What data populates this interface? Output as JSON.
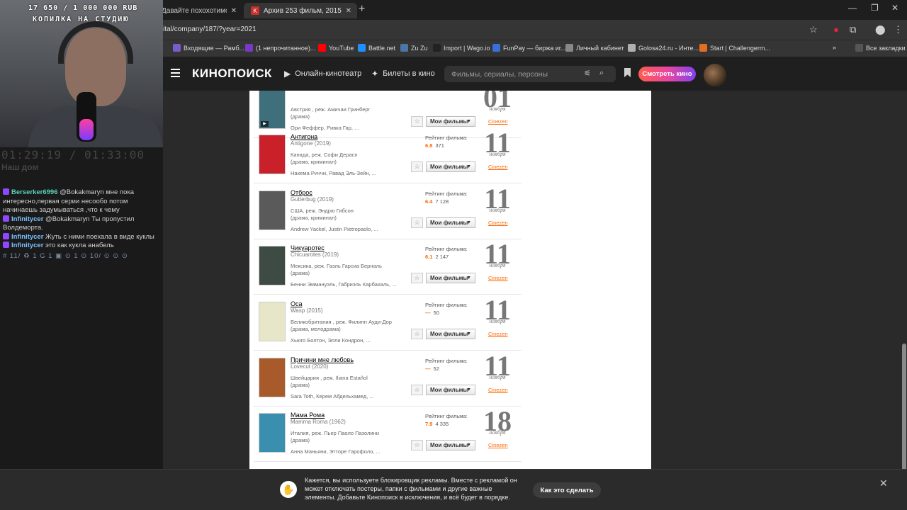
{
  "overlay": {
    "counter": "17 650 / 1 000 000 RUB",
    "kopilka": "КОПИЛКА НА СТУДИЮ",
    "timer": "01:29:19 / 01:33:00",
    "stream_title": "Наш дом",
    "chat": [
      {
        "user": "Berserker6996",
        "text": " @Bokakmaryn мне пока интересно,первая серии несообо потом начинаешь задумываться ,что к чему"
      },
      {
        "user": "Infinitycer",
        "text": " @Bokakmaryn Ты пропустил Волдеморта."
      },
      {
        "user": "Infinitycer",
        "text": " Жуть с ними поехала в виде куклы"
      },
      {
        "user": "Infinitycer",
        "text": " это как кукла анабель"
      }
    ],
    "ticker": "# 11/ ♻ 1 G 1 ▣ ⊙ 1 ⊙ 10/ ⊙ ⊙ ⊙"
  },
  "browser": {
    "tabs": [
      {
        "label": "Давайте похохотимся фильм, 2",
        "favicon": "K"
      },
      {
        "label": "Архив 253 фильм, 2015, дата с",
        "favicon": "K"
      }
    ],
    "url": "kinopoisk.ru/comingsoon/digital/company/187/?year=2021",
    "bookmarks": [
      {
        "label": "Входящие — Рамб...",
        "color": "#7a5cc7"
      },
      {
        "label": "(1 непрочитанное)...",
        "color": "#7a38c7"
      },
      {
        "label": "YouTube",
        "color": "#ff0000"
      },
      {
        "label": "Battle.net",
        "color": "#1e90ff"
      },
      {
        "label": "Zu Zu",
        "color": "#4a76a8"
      },
      {
        "label": "Import | Wago.io",
        "color": "#222222"
      },
      {
        "label": "FunPay — биржа иг...",
        "color": "#3a6fd8"
      },
      {
        "label": "Личный кабинет",
        "color": "#888888"
      },
      {
        "label": "Golosa24.ru - Инте...",
        "color": "#b0b0b0"
      },
      {
        "label": "Start | Challengerm...",
        "color": "#e07020"
      }
    ],
    "all_bookmarks": "Все закладки"
  },
  "kp_header": {
    "logo": "КИНОПОИСК",
    "nav_online": "Онлайн-кинотеатр",
    "nav_tickets": "Билеты в кино",
    "search_placeholder": "Фильмы, сериалы, персоны",
    "watch_button": "Смотреть кино"
  },
  "films": [
    {
      "title": "",
      "original": "",
      "country": "Австрия , реж. Амичаи Гринберг",
      "genre": "(драма)",
      "actors": "Ори Феффер, Ривка Гар, ...",
      "rating_label": "",
      "score": "",
      "votes": "",
      "day": "01",
      "month": "ноября",
      "distributor": "Cinezen",
      "my_films": "Мои фильмы",
      "poster_color": "#3f6f7a"
    },
    {
      "title": "Антигона",
      "original": "Antigone (2019)",
      "country": "Канада, реж. Софи Дерасп",
      "genre": "(драма, криминал)",
      "actors": "Нахема Риччи, Равад Эль-Зейн, ...",
      "rating_label": "Рейтинг фильма:",
      "score": "6.8",
      "votes": "371",
      "day": "11",
      "month": "ноября",
      "distributor": "Cinezen",
      "my_films": "Мои фильмы",
      "poster_color": "#c9202a"
    },
    {
      "title": "Отброс",
      "original": "Gutterbug (2019)",
      "country": "США, реж. Эндрю Гибсон",
      "genre": "(драма, криминал)",
      "actors": "Andrew Yackel, Justin Pietropaolo, ...",
      "rating_label": "Рейтинг фильма:",
      "score": "6.4",
      "votes": "7 128",
      "day": "11",
      "month": "ноября",
      "distributor": "Cinezen",
      "my_films": "Мои фильмы",
      "poster_color": "#5a5a5a"
    },
    {
      "title": "Чикуаротес",
      "original": "Chicuarotes (2019)",
      "country": "Мексика, реж. Гаэль Гарсиа Берналь",
      "genre": "(драма)",
      "actors": "Бенни Эммануэль, Габриэль Карбахаль, ...",
      "rating_label": "Рейтинг фильма:",
      "score": "6.1",
      "votes": "2 147",
      "day": "11",
      "month": "ноября",
      "distributor": "Cinezen",
      "my_films": "Мои фильмы",
      "poster_color": "#3e4a44"
    },
    {
      "title": "Оса",
      "original": "Wasp (2015)",
      "country": "Великобритания , реж. Филипп Ауди-Дор",
      "genre": "(драма, мелодрама)",
      "actors": "Хьюго Болтон, Элли Кондрон, ...",
      "rating_label": "Рейтинг фильма:",
      "score": "—",
      "votes": "50",
      "day": "11",
      "month": "ноября",
      "distributor": "Cinezen",
      "my_films": "Мои фильмы",
      "poster_color": "#e8e6c8"
    },
    {
      "title": "Причини мне любовь",
      "original": "Lovecut (2020)",
      "country": "Швейцария , реж. Iliana Estañol",
      "genre": "(драма)",
      "actors": "Sara Toth, Керем Абдельхамед, ...",
      "rating_label": "Рейтинг фильма:",
      "score": "—",
      "votes": "52",
      "day": "11",
      "month": "ноября",
      "distributor": "Cinezen",
      "my_films": "Мои фильмы",
      "poster_color": "#a85a2a"
    },
    {
      "title": "Мама Рома",
      "original": "Mamma Roma (1962)",
      "country": "Италия, реж. Пьер Паоло Пазолини",
      "genre": "(драма)",
      "actors": "Анна Маньяни, Этторе Гарофоло, ...",
      "rating_label": "Рейтинг фильма:",
      "score": "7.9",
      "votes": "4 335",
      "day": "18",
      "month": "ноября",
      "distributor": "Cinezen",
      "my_films": "Мои фильмы",
      "poster_color": "#3b8fae"
    }
  ],
  "ad_banner": {
    "text": "Кажется, вы используете блокировщик рекламы. Вместе с рекламой он может отключать постеры, папки с фильмами и другие важные элементы. Добавьте Кинопоиск в исключения, и всё будет в порядке.",
    "button": "Как это сделать"
  }
}
